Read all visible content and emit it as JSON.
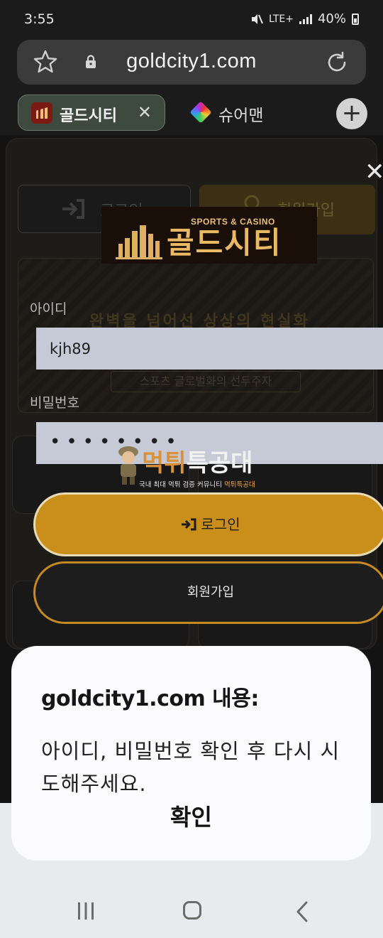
{
  "status_bar": {
    "time": "3:55",
    "network": "LTE+",
    "battery": "40%"
  },
  "address_bar": {
    "url": "goldcity1.com"
  },
  "tabs": [
    {
      "title": "골드시티",
      "active": true
    },
    {
      "title": "슈어맨",
      "active": false
    }
  ],
  "background_page": {
    "login_label": "로그인",
    "join_label": "회원가입",
    "banner_title": "완벽을 넘어선 상상의 현실화",
    "banner_sub": "스포츠 글로벌화의 선두주자"
  },
  "login_form": {
    "logo_tagline": "SPORTS & CASINO",
    "logo_text": "골드시티",
    "id_label": "아이디",
    "id_value": "kjh89",
    "password_label": "비밀번호",
    "password_mask": "••••••••",
    "login_button": "로그인",
    "signup_button": "회원가입",
    "close_symbol": "✕"
  },
  "watermark": {
    "title_part1": "먹튀",
    "title_part2": "특공대",
    "subtitle_part1": "국내 최대 먹튀 검증 커뮤니티 ",
    "subtitle_part2": "먹튀특공대"
  },
  "dialog": {
    "title": "goldcity1.com 내용:",
    "message": "아이디, 비밀번호 확인 후 다시 시도해주세요.",
    "ok_button": "확인"
  },
  "colors": {
    "gold_accent": "#c98f1a",
    "input_bg": "#c5cad6",
    "dialog_bg": "#fbfbfd"
  }
}
